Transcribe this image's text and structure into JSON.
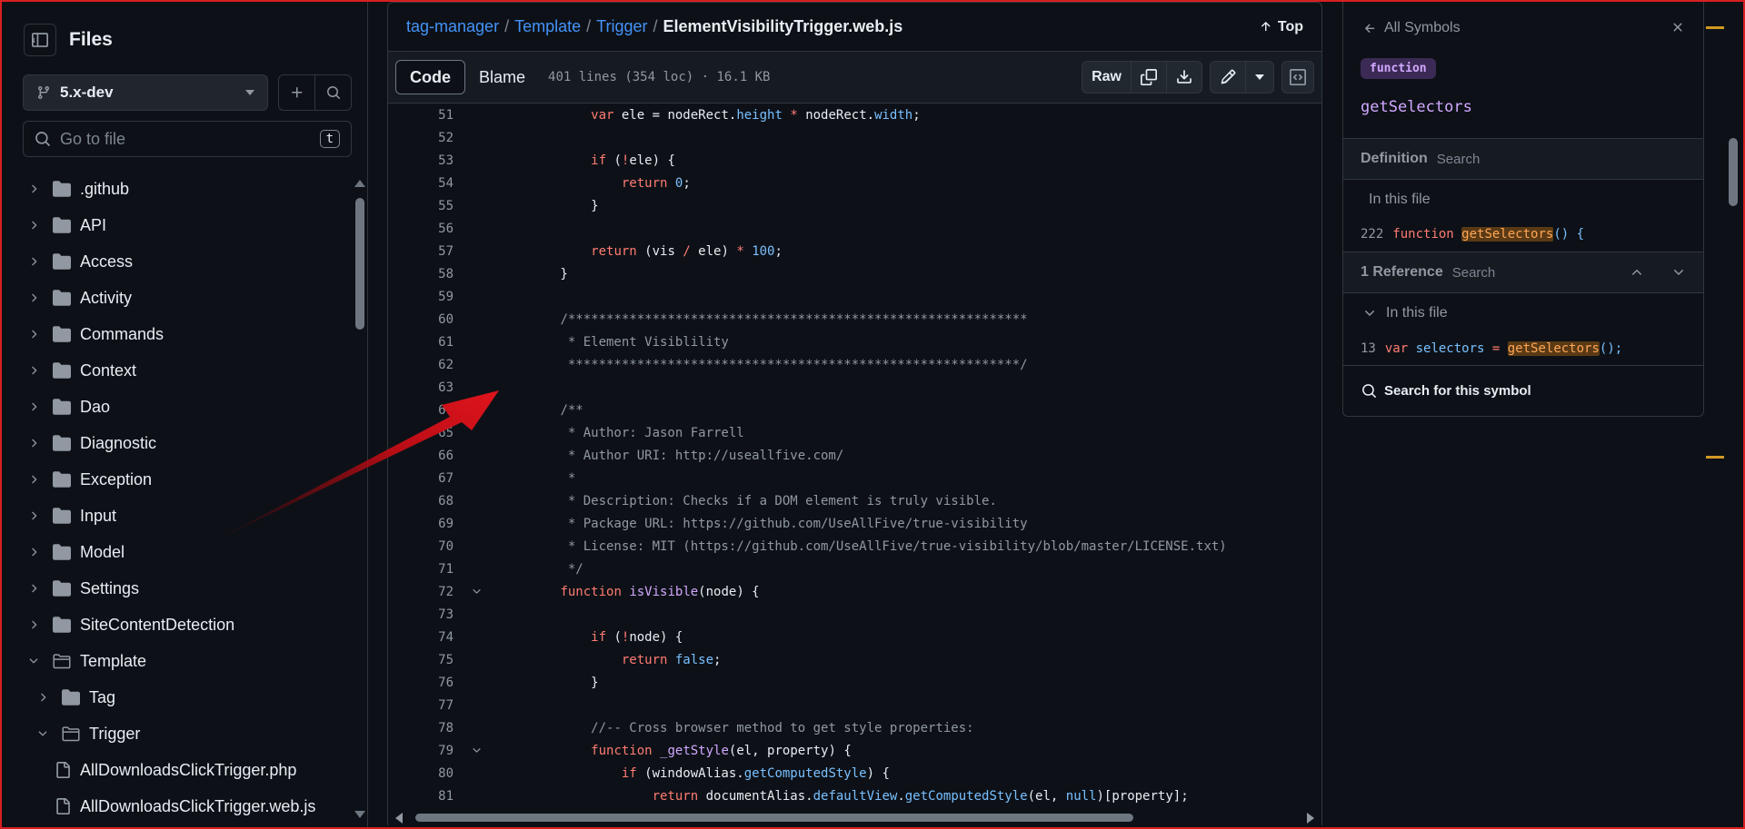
{
  "sidebar": {
    "title": "Files",
    "branch": "5.x-dev",
    "search_placeholder": "Go to file",
    "search_shortcut": "t",
    "tree": [
      {
        "label": ".github",
        "type": "folder",
        "expanded": false,
        "depth": 0
      },
      {
        "label": "API",
        "type": "folder",
        "expanded": false,
        "depth": 0
      },
      {
        "label": "Access",
        "type": "folder",
        "expanded": false,
        "depth": 0
      },
      {
        "label": "Activity",
        "type": "folder",
        "expanded": false,
        "depth": 0
      },
      {
        "label": "Commands",
        "type": "folder",
        "expanded": false,
        "depth": 0
      },
      {
        "label": "Context",
        "type": "folder",
        "expanded": false,
        "depth": 0
      },
      {
        "label": "Dao",
        "type": "folder",
        "expanded": false,
        "depth": 0
      },
      {
        "label": "Diagnostic",
        "type": "folder",
        "expanded": false,
        "depth": 0
      },
      {
        "label": "Exception",
        "type": "folder",
        "expanded": false,
        "depth": 0
      },
      {
        "label": "Input",
        "type": "folder",
        "expanded": false,
        "depth": 0
      },
      {
        "label": "Model",
        "type": "folder",
        "expanded": false,
        "depth": 0
      },
      {
        "label": "Settings",
        "type": "folder",
        "expanded": false,
        "depth": 0
      },
      {
        "label": "SiteContentDetection",
        "type": "folder",
        "expanded": false,
        "depth": 0
      },
      {
        "label": "Template",
        "type": "folder",
        "expanded": true,
        "depth": 0
      },
      {
        "label": "Tag",
        "type": "folder",
        "expanded": false,
        "depth": 1
      },
      {
        "label": "Trigger",
        "type": "folder",
        "expanded": true,
        "depth": 1
      },
      {
        "label": "AllDownloadsClickTrigger.php",
        "type": "file",
        "depth": 2
      },
      {
        "label": "AllDownloadsClickTrigger.web.js",
        "type": "file",
        "depth": 2
      }
    ]
  },
  "breadcrumb": {
    "repo": "tag-manager",
    "parts": [
      "Template",
      "Trigger"
    ],
    "file": "ElementVisibilityTrigger.web.js",
    "top_label": "Top",
    "separator": "/"
  },
  "toolbar": {
    "code_tab": "Code",
    "blame_tab": "Blame",
    "meta": "401 lines (354 loc) · 16.1 KB",
    "raw_label": "Raw"
  },
  "code_lines": [
    {
      "n": "51",
      "fold": false,
      "html": "            <span>var</span> ele = nodeRect.<span class=\"p\">height</span> <span class=\"o\">*</span> nodeRect.<span class=\"p\">width</span>;"
    },
    {
      "n": "52",
      "fold": false,
      "html": ""
    },
    {
      "n": "53",
      "fold": false,
      "html": "            <span class=\"k\">if</span> (<span class=\"o\">!</span>ele) {"
    },
    {
      "n": "54",
      "fold": false,
      "html": "                <span class=\"k\">return</span> <span class=\"p\">0</span>;"
    },
    {
      "n": "55",
      "fold": false,
      "html": "            }"
    },
    {
      "n": "56",
      "fold": false,
      "html": ""
    },
    {
      "n": "57",
      "fold": false,
      "html": "            <span class=\"k\">return</span> (vis <span class=\"o\">/</span> ele) <span class=\"o\">*</span> <span class=\"p\">100</span>;"
    },
    {
      "n": "58",
      "fold": false,
      "html": "        }"
    },
    {
      "n": "59",
      "fold": false,
      "html": ""
    },
    {
      "n": "60",
      "fold": false,
      "html": "        <span class=\"c\">/************************************************************</span>"
    },
    {
      "n": "61",
      "fold": false,
      "html": "<span class=\"c\">         * Element Visiblility</span>"
    },
    {
      "n": "62",
      "fold": false,
      "html": "<span class=\"c\">         ***********************************************************/</span>"
    },
    {
      "n": "63",
      "fold": false,
      "html": ""
    },
    {
      "n": "64",
      "fold": false,
      "html": "        <span class=\"c\">/**</span>"
    },
    {
      "n": "65",
      "fold": false,
      "html": "<span class=\"c\">         * Author: Jason Farrell</span>"
    },
    {
      "n": "66",
      "fold": false,
      "html": "<span class=\"c\">         * Author URI: http://useallfive.com/</span>"
    },
    {
      "n": "67",
      "fold": false,
      "html": "<span class=\"c\">         *</span>"
    },
    {
      "n": "68",
      "fold": false,
      "html": "<span class=\"c\">         * Description: Checks if a DOM element is truly visible.</span>"
    },
    {
      "n": "69",
      "fold": false,
      "html": "<span class=\"c\">         * Package URL: https://github.com/UseAllFive/true-visibility</span>"
    },
    {
      "n": "70",
      "fold": false,
      "html": "<span class=\"c\">         * License: MIT (https://github.com/UseAllFive/true-visibility/blob/master/LICENSE.txt)</span>"
    },
    {
      "n": "71",
      "fold": false,
      "html": "<span class=\"c\">         */</span>"
    },
    {
      "n": "72",
      "fold": true,
      "html": "        <span class=\"k\">function</span> <span class=\"f\">isVisible</span>(node) {"
    },
    {
      "n": "73",
      "fold": false,
      "html": ""
    },
    {
      "n": "74",
      "fold": false,
      "html": "            <span class=\"k\">if</span> (<span class=\"o\">!</span>node) {"
    },
    {
      "n": "75",
      "fold": false,
      "html": "                <span class=\"k\">return</span> <span class=\"p\">false</span>;"
    },
    {
      "n": "76",
      "fold": false,
      "html": "            }"
    },
    {
      "n": "77",
      "fold": false,
      "html": ""
    },
    {
      "n": "78",
      "fold": false,
      "html": "            <span class=\"c\">//-- Cross browser method to get style properties:</span>"
    },
    {
      "n": "79",
      "fold": true,
      "html": "            <span class=\"k\">function</span> <span class=\"f\">_getStyle</span>(el, property) {"
    },
    {
      "n": "80",
      "fold": false,
      "html": "                <span class=\"k\">if</span> (windowAlias.<span class=\"p\">getComputedStyle</span>) {"
    },
    {
      "n": "81",
      "fold": false,
      "html": "                    <span class=\"k\">return</span> documentAlias.<span class=\"p\">defaultView</span>.<span class=\"p\">getComputedStyle</span>(el, <span class=\"p\">null</span>)[property];"
    }
  ],
  "symbols_panel": {
    "back_label": "All Symbols",
    "kind": "function",
    "name": "getSelectors",
    "definition_label": "Definition",
    "definition_search": "Search",
    "def_in_file": "In this file",
    "def_line_no": "222",
    "def_pre": "function ",
    "def_name": "getSelectors",
    "def_post": "() {",
    "reference_label": "1 Reference",
    "reference_search": "Search",
    "ref_in_file": "In this file",
    "ref_line_no": "13",
    "ref_var": "var",
    "ref_ident": "selectors",
    "ref_eq": " = ",
    "ref_name": "getSelectors",
    "ref_post": "();",
    "search_symbol_label": "Search for this symbol"
  },
  "colors": {
    "background": "#0d1117",
    "link": "#4493f8",
    "keyword": "#ff7b72",
    "function": "#d2a8ff",
    "annotation_arrow": "#d0101a"
  }
}
